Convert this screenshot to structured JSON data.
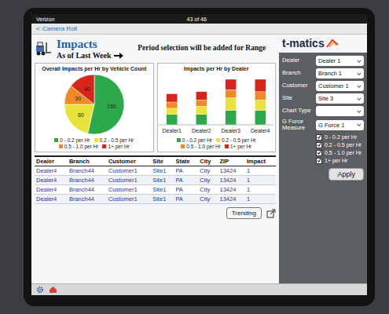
{
  "status_bar": {
    "carrier": "Verizon",
    "page": "43 of 46"
  },
  "nav": {
    "back_glyph": "<",
    "back": "Camera Roll"
  },
  "header": {
    "title": "Impacts",
    "subtitle": "As of Last Week",
    "note": "Period selection will be added for Range"
  },
  "logo": "t-matics",
  "filters": [
    {
      "label": "Dealer",
      "value": "Dealer 1"
    },
    {
      "label": "Branch",
      "value": "Branch 1"
    },
    {
      "label": "Customer",
      "value": "Customer 1"
    },
    {
      "label": "Site",
      "value": "Site 3"
    },
    {
      "label": "Chart Type",
      "value": ""
    },
    {
      "label": "G Force Measure",
      "value": "G Force 1"
    }
  ],
  "ranges": [
    {
      "label": "0 - 0.2 per Hr",
      "checked": true
    },
    {
      "label": "0.2 - 0.5 per Hr",
      "checked": true
    },
    {
      "label": "0.5 - 1.0 per Hr",
      "checked": true
    },
    {
      "label": "1+ per Hr",
      "checked": true
    }
  ],
  "apply": "Apply",
  "pie": {
    "title": "Overall Impacts per Hr by Vehicle Count",
    "slices": [
      {
        "label": "0 - 0.2 per Hr",
        "value": 150,
        "reading": "150",
        "color": "#2da84a"
      },
      {
        "label": "0.2 - 0.5 per Hr",
        "value": 60,
        "reading": "60",
        "color": "#e8e23a"
      },
      {
        "label": "0.5 - 1.0 per Hr",
        "value": 30,
        "reading": "30",
        "color": "#f08a24"
      },
      {
        "label": "1+ per Hr",
        "value": 40,
        "reading": "40",
        "color": "#d9241c"
      }
    ]
  },
  "bar": {
    "title": "Impacts per Hr by Dealer",
    "categories": [
      "Dealer1",
      "Dealer2",
      "Dealer3",
      "Dealer4"
    ],
    "series": [
      {
        "name": "0 - 0.2 per Hr",
        "color": "#2da84a",
        "values": [
          1.0,
          1.0,
          1.4,
          1.4
        ]
      },
      {
        "name": "0.2 - 0.5 per Hr",
        "color": "#e8e23a",
        "values": [
          0.6,
          0.8,
          1.2,
          1.0
        ]
      },
      {
        "name": "0.5 - 1.0 per Hr",
        "color": "#f08a24",
        "values": [
          0.6,
          0.6,
          0.8,
          0.8
        ]
      },
      {
        "name": "1+ per Hr",
        "color": "#d9241c",
        "values": [
          0.8,
          0.8,
          1.0,
          1.2
        ]
      }
    ]
  },
  "table": {
    "columns": [
      "Dealer",
      "Branch",
      "Customer",
      "Site",
      "State",
      "City",
      "ZIP",
      "Impact"
    ],
    "rows": [
      [
        "Dealer4",
        "Branch44",
        "Customer1",
        "Site1",
        "PA",
        "City",
        "13424",
        "1"
      ],
      [
        "Dealer4",
        "Branch44",
        "Customer1",
        "Site1",
        "PA",
        "City",
        "13424",
        "1"
      ],
      [
        "Dealer4",
        "Branch44",
        "Customer1",
        "Site1",
        "PA",
        "City",
        "13424",
        "1"
      ],
      [
        "Dealer4",
        "Branch44",
        "Customer1",
        "Site1",
        "PA",
        "City",
        "13424",
        "1"
      ]
    ]
  },
  "trending": "Trending"
}
